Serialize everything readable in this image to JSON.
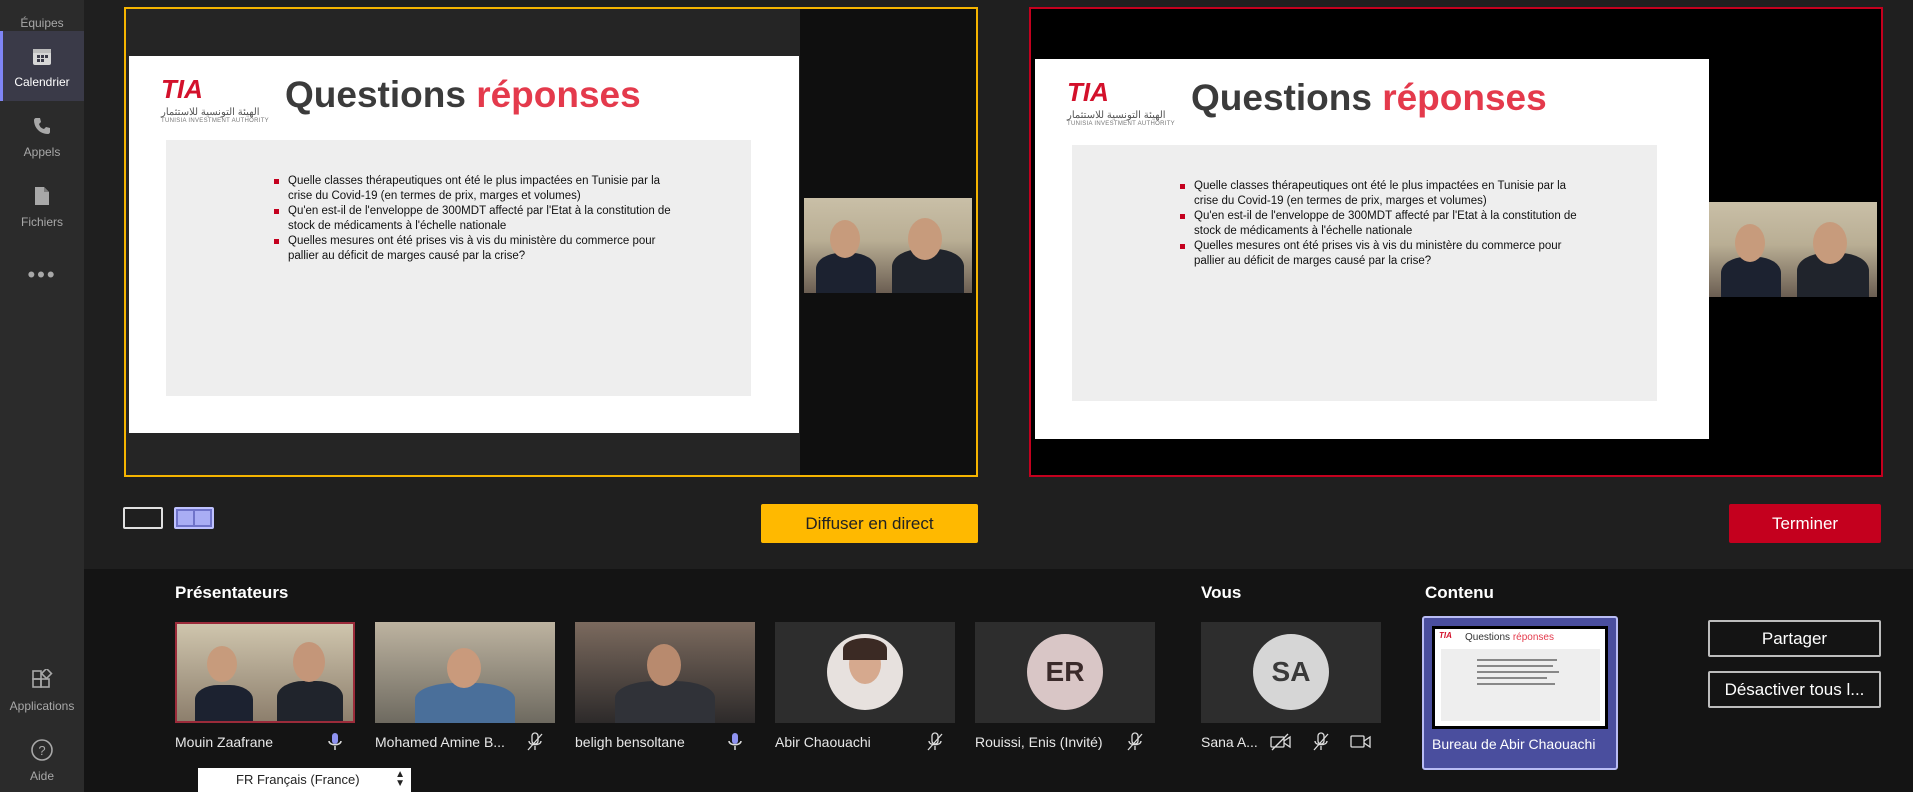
{
  "rail": {
    "items": [
      {
        "label": "Équipes"
      },
      {
        "label": "Calendrier"
      },
      {
        "label": "Appels"
      },
      {
        "label": "Fichiers"
      },
      {
        "label": "Applications"
      },
      {
        "label": "Aide"
      }
    ],
    "more": "•••"
  },
  "slide": {
    "logo_text": "TIA",
    "logo_arabic": "الهيئة التونسية للاستثمار",
    "logo_sub": "TUNISIA INVESTMENT AUTHORITY",
    "title_part1": "Questions ",
    "title_part2": "réponses",
    "bullets": [
      "Quelle classes thérapeutiques ont été le plus impactées en Tunisie par la crise du Covid-19 (en termes de prix, marges et volumes)",
      "Qu'en est-il de l'enveloppe de 300MDT affecté par l'Etat à la constitution de stock de médicaments à l'échelle nationale",
      "Quelles mesures ont été prises vis à vis du ministère du commerce pour pallier au déficit de marges causé par la crise?"
    ]
  },
  "controls": {
    "live_label": "Diffuser en direct",
    "end_label": "Terminer"
  },
  "sections": {
    "presenters": "Présentateurs",
    "you": "Vous",
    "content": "Contenu"
  },
  "participants": [
    {
      "name": "Mouin Zaafrane",
      "mic": "on"
    },
    {
      "name": "Mohamed Amine B...",
      "mic": "muted"
    },
    {
      "name": "beligh bensoltane",
      "mic": "on"
    },
    {
      "name": "Abir Chaouachi",
      "mic": "muted"
    },
    {
      "name": "Rouissi, Enis (Invité)",
      "mic": "muted",
      "initials": "ER"
    }
  ],
  "you": {
    "name": "Sana A...",
    "initials": "SA"
  },
  "content": {
    "name": "Bureau de Abir Chaouachi",
    "thumb_title1": "Questions ",
    "thumb_title2": "réponses"
  },
  "side_buttons": {
    "share": "Partager",
    "mute_all": "Désactiver tous l..."
  },
  "language": {
    "value": "FR Français (France)"
  },
  "colors": {
    "queue_border": "#f5b400",
    "live_border": "#c4001e",
    "accent": "#e43a4c"
  }
}
